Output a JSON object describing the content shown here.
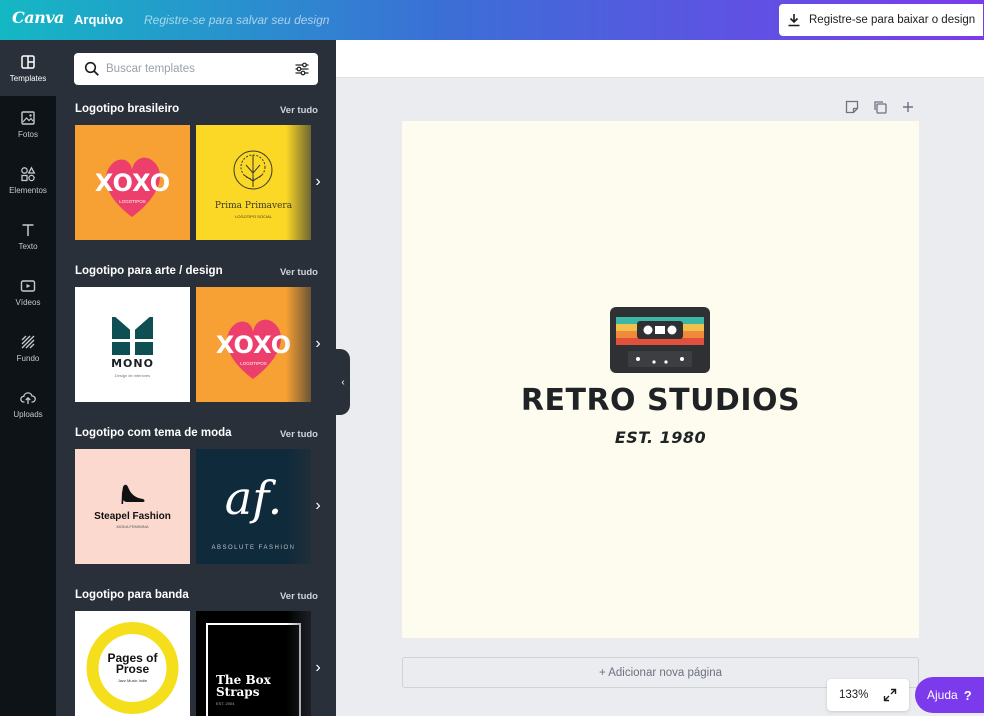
{
  "topbar": {
    "logo": "Canva",
    "file_menu": "Arquivo",
    "title_placeholder": "Registre-se para salvar seu design",
    "signup_download": "Registre-se para baixar o design",
    "gradient": [
      "#14b8c4",
      "#3b6fd6",
      "#7c3aed"
    ]
  },
  "sidebar": {
    "items": [
      {
        "label": "Templates",
        "icon": "templates-icon",
        "active": true
      },
      {
        "label": "Fotos",
        "icon": "photo-icon"
      },
      {
        "label": "Elementos",
        "icon": "shapes-icon"
      },
      {
        "label": "Texto",
        "icon": "text-icon"
      },
      {
        "label": "Vídeos",
        "icon": "video-icon"
      },
      {
        "label": "Fundo",
        "icon": "background-icon"
      },
      {
        "label": "Uploads",
        "icon": "upload-icon"
      }
    ]
  },
  "panel": {
    "search_placeholder": "Buscar templates",
    "see_all": "Ver tudo",
    "sections": [
      {
        "title": "Logotipo brasileiro",
        "thumbs": [
          {
            "text": "XOXO",
            "sub": "LOGOTIPOS",
            "bg": "#f7a033"
          },
          {
            "text": "Prima Primavera",
            "sub": "LOGOTIPO SOCIAL",
            "bg": "#fbd726"
          }
        ]
      },
      {
        "title": "Logotipo para arte / design",
        "thumbs": [
          {
            "text": "MONO",
            "sub": "Design de interiores",
            "bg": "#ffffff"
          },
          {
            "text": "XOXO",
            "sub": "LOGOTIPOS",
            "bg": "#f7a033"
          }
        ]
      },
      {
        "title": "Logotipo com tema de moda",
        "thumbs": [
          {
            "text": "Steapel Fashion",
            "sub": "MODA FEMININA",
            "bg": "#fcd9cf"
          },
          {
            "text": "af.",
            "sub": "ABSOLUTE FASHION",
            "bg": "#0f2a3a"
          }
        ]
      },
      {
        "title": "Logotipo para banda",
        "thumbs": [
          {
            "text": "Pages of Prose",
            "sub": "Jazz Music Indie",
            "bg": "#ffffff"
          },
          {
            "text": "The Box Straps",
            "sub": "EST. 2004",
            "bg": "#000000"
          }
        ]
      }
    ]
  },
  "canvas": {
    "brand": "RETRO STUDIOS",
    "est": "EST. 1980",
    "background": "#fdfcef",
    "add_page": "+ Adicionar nova página"
  },
  "footer": {
    "zoom": "133%",
    "help": "Ajuda",
    "help_mark": "?"
  }
}
